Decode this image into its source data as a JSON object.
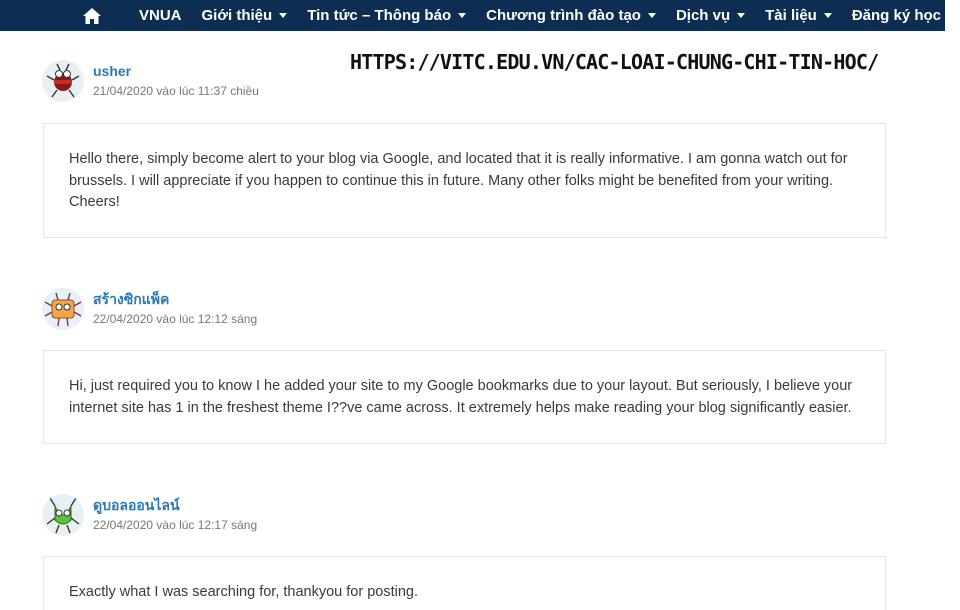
{
  "nav": {
    "home_icon": "home-icon",
    "items": [
      {
        "label": "VNUA",
        "dropdown": false
      },
      {
        "label": "Giới thiệu",
        "dropdown": true
      },
      {
        "label": "Tin tức – Thông báo",
        "dropdown": true
      },
      {
        "label": "Chương trình đào tạo",
        "dropdown": true
      },
      {
        "label": "Dịch vụ",
        "dropdown": true
      },
      {
        "label": "Tài liệu",
        "dropdown": true
      },
      {
        "label": "Đăng ký học",
        "dropdown": false
      }
    ]
  },
  "watermark_url": "HTTPS://VITC.EDU.VN/CAC-LOAI-CHUNG-CHI-TIN-HOC/",
  "comments": [
    {
      "author": "usher",
      "date": "21/04/2020 vào lúc 11:37 chiều",
      "text": "Hello there, simply become alert to your blog via Google, and located that it is really informative. I am gonna watch out for brussels. I will appreciate if you happen to continue this in future. Many other folks might be benefited from your writing. Cheers!"
    },
    {
      "author": "สร้างซิกแพ็ค",
      "date": "22/04/2020 vào lúc 12:12 sáng",
      "text": "Hi, just required you to know I he added your site to my Google bookmarks due to your layout. But seriously, I believe your internet site has 1 in the freshest theme I??ve came across. It extremely helps make reading your blog significantly easier."
    },
    {
      "author": "ดูบอลออนไลน์",
      "date": "22/04/2020 vào lúc 12:17 sáng",
      "text": "Exactly what I was searching for, thankyou for posting."
    }
  ],
  "colors": {
    "nav_bg": "#0d2d52",
    "author_link": "#2b78b8"
  }
}
